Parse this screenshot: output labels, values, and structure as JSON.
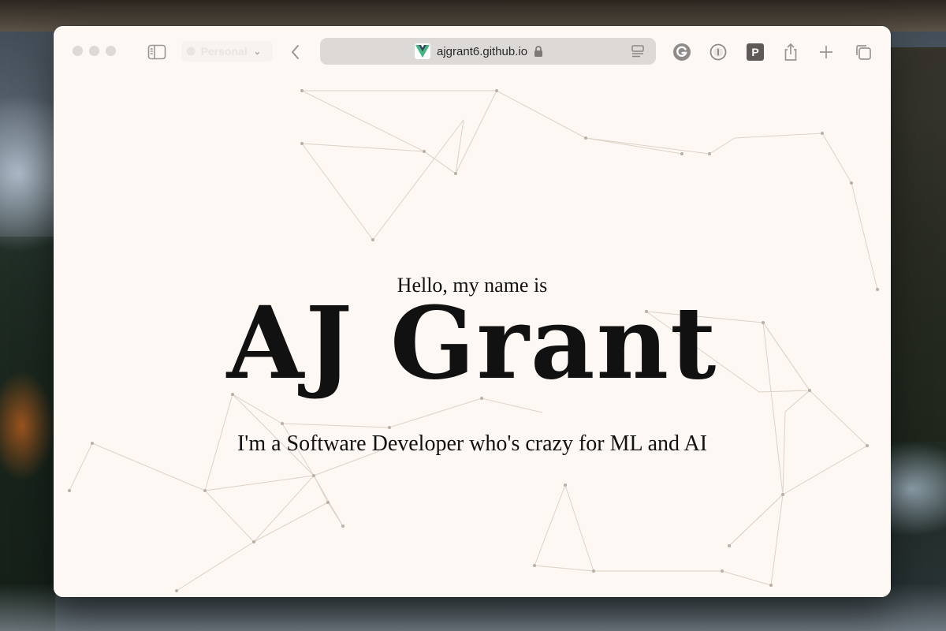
{
  "browser": {
    "profile_label": "Personal",
    "url": "ajgrant6.github.io",
    "url_secure": true,
    "icons": {
      "sidebar": "sidebar-icon",
      "back": "chevron-left-icon",
      "reader": "reader-mode-icon",
      "grammarly": "grammarly-icon",
      "onepassword": "onepassword-icon",
      "pextension": "p-extension-icon",
      "share": "share-icon",
      "new_tab": "plus-icon",
      "tab_overview": "tab-overview-icon"
    },
    "p_extension_label": "P"
  },
  "page": {
    "greeting": "Hello, my name is",
    "name": "AJ Grant",
    "tagline": "I'm a Software Developer who's crazy for ML and AI"
  },
  "colors": {
    "page_bg": "#fdf8f3",
    "text": "#111111",
    "network_line": "#d8cfc4",
    "network_node": "#b9afa4",
    "vue_green": "#41b883",
    "vue_dark": "#35495e"
  }
}
